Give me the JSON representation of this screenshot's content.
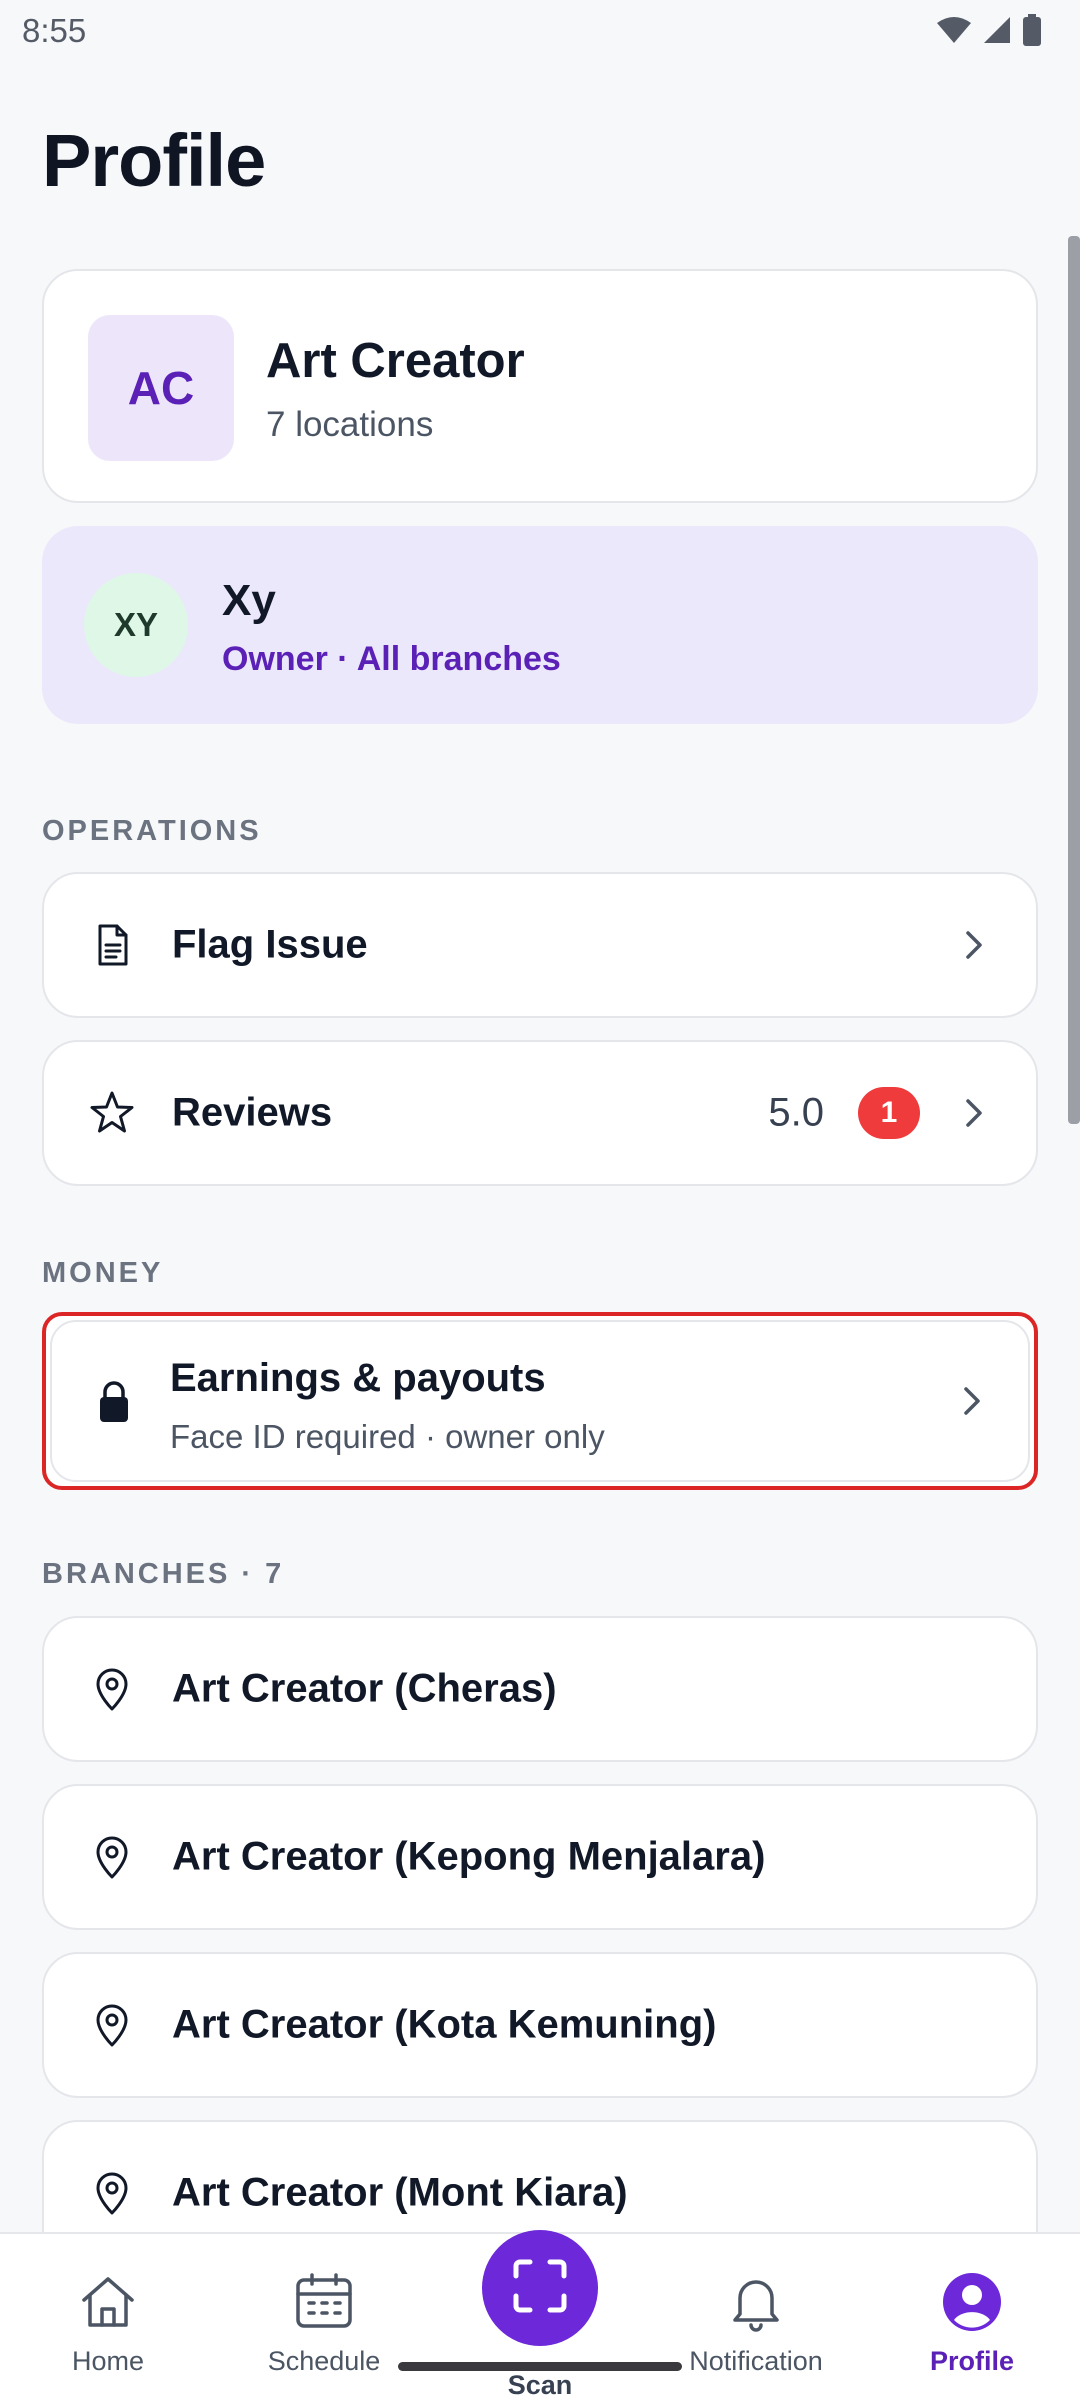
{
  "status_bar": {
    "time": "8:55"
  },
  "header": {
    "title": "Profile"
  },
  "business": {
    "initials": "AC",
    "name": "Art Creator",
    "subtitle": "7 locations"
  },
  "user": {
    "initials": "XY",
    "name": "Xy",
    "role": "Owner · All branches"
  },
  "sections": {
    "operations": "OPERATIONS",
    "money": "MONEY",
    "branches": "BRANCHES · 7"
  },
  "operations": {
    "flag_issue": {
      "label": "Flag Issue",
      "icon": "document-icon"
    },
    "reviews": {
      "label": "Reviews",
      "rating": "5.0",
      "badge": "1",
      "icon": "star-icon"
    }
  },
  "money": {
    "earnings": {
      "label": "Earnings & payouts",
      "subtitle": "Face ID required · owner only",
      "icon": "lock-icon"
    }
  },
  "branches": [
    {
      "label": "Art Creator (Cheras)"
    },
    {
      "label": "Art Creator (Kepong Menjalara)"
    },
    {
      "label": "Art Creator (Kota Kemuning)"
    },
    {
      "label": "Art Creator (Mont Kiara)"
    }
  ],
  "nav": {
    "home": "Home",
    "schedule": "Schedule",
    "scan": "Scan",
    "notification": "Notification",
    "profile": "Profile",
    "active": "profile"
  },
  "colors": {
    "accent": "#6D28D9",
    "accent_text": "#5B21B6",
    "user_card_bg": "#ECE8FB",
    "badge": "#EF3B3B",
    "highlight_border": "#DC2626"
  }
}
